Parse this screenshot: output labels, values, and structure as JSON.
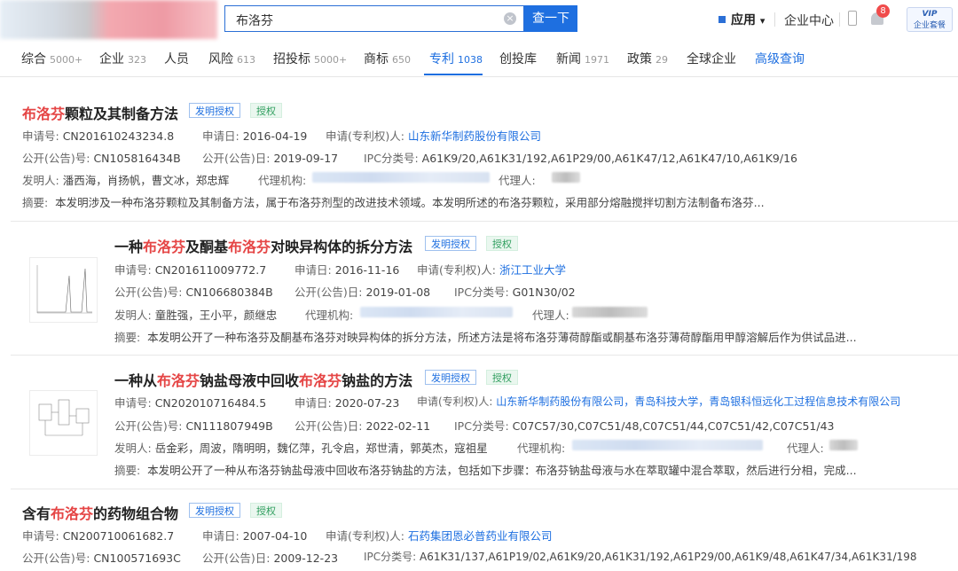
{
  "header": {
    "search": {
      "value": "布洛芬",
      "clear": "×",
      "button": "查一下"
    },
    "apps_label": "应用",
    "apps_caret": "▾",
    "enterprise_center": "企业中心",
    "notification_count": "8",
    "vip": {
      "top": "VIP",
      "bottom": "企业套餐"
    }
  },
  "tabs": [
    {
      "label": "综合",
      "count": "5000+"
    },
    {
      "label": "企业",
      "count": "323"
    },
    {
      "label": "人员",
      "count": ""
    },
    {
      "label": "风险",
      "count": "613"
    },
    {
      "label": "招投标",
      "count": "5000+"
    },
    {
      "label": "商标",
      "count": "650"
    },
    {
      "label": "专利",
      "count": "1038"
    },
    {
      "label": "创投库",
      "count": ""
    },
    {
      "label": "新闻",
      "count": "1971"
    },
    {
      "label": "政策",
      "count": "29"
    },
    {
      "label": "全球企业",
      "count": ""
    },
    {
      "label": "高级查询",
      "count": ""
    }
  ],
  "active_tab": "专利",
  "results": [
    {
      "title_parts": [
        {
          "t": "布洛芬",
          "hl": true
        },
        {
          "t": "颗粒及其制备方法",
          "hl": false
        }
      ],
      "tag_type": "发明授权",
      "tag_status": "授权",
      "app_no_label": "申请号:",
      "app_no": "CN201610243234.8",
      "app_date_label": "申请日:",
      "app_date": "2016-04-19",
      "applicant_label": "申请(专利权)人:",
      "applicant": "山东新华制药股份有限公司",
      "pub_no_label": "公开(公告)号:",
      "pub_no": "CN105816434B",
      "pub_date_label": "公开(公告)日:",
      "pub_date": "2019-09-17",
      "ipc_label": "IPC分类号:",
      "ipc": "A61K9/20,A61K31/192,A61P29/00,A61K47/12,A61K47/10,A61K9/16",
      "inventor_label": "发明人:",
      "inventors": "潘西海，肖扬帆，曹文冰，郑忠辉",
      "agency_label": "代理机构:",
      "agent_label": "代理人:",
      "abstract_label": "摘要:",
      "abstract": "本发明涉及一种布洛芬颗粒及其制备方法，属于布洛芬剂型的改进技术领域。本发明所述的布洛芬颗粒，采用部分熔融搅拌切割方法制备布洛芬..."
    },
    {
      "title_parts": [
        {
          "t": "一种",
          "hl": false
        },
        {
          "t": "布洛芬",
          "hl": true
        },
        {
          "t": "及酮基",
          "hl": false
        },
        {
          "t": "布洛芬",
          "hl": true
        },
        {
          "t": "对映异构体的拆分方法",
          "hl": false
        }
      ],
      "tag_type": "发明授权",
      "tag_status": "授权",
      "app_no_label": "申请号:",
      "app_no": "CN201611009772.7",
      "app_date_label": "申请日:",
      "app_date": "2016-11-16",
      "applicant_label": "申请(专利权)人:",
      "applicant": "浙江工业大学",
      "pub_no_label": "公开(公告)号:",
      "pub_no": "CN106680384B",
      "pub_date_label": "公开(公告)日:",
      "pub_date": "2019-01-08",
      "ipc_label": "IPC分类号:",
      "ipc": "G01N30/02",
      "inventor_label": "发明人:",
      "inventors": "童胜强，王小平，颜继忠",
      "agency_label": "代理机构:",
      "agent_label": "代理人:",
      "abstract_label": "摘要:",
      "abstract": "本发明公开了一种布洛芬及酮基布洛芬对映异构体的拆分方法，所述方法是将布洛芬薄荷醇酯或酮基布洛芬薄荷醇酯用甲醇溶解后作为供试品进..."
    },
    {
      "title_parts": [
        {
          "t": "一种从",
          "hl": false
        },
        {
          "t": "布洛芬",
          "hl": true
        },
        {
          "t": "钠盐母液中回收",
          "hl": false
        },
        {
          "t": "布洛芬",
          "hl": true
        },
        {
          "t": "钠盐的方法",
          "hl": false
        }
      ],
      "tag_type": "发明授权",
      "tag_status": "授权",
      "app_no_label": "申请号:",
      "app_no": "CN202010716484.5",
      "app_date_label": "申请日:",
      "app_date": "2020-07-23",
      "applicant_label": "申请(专利权)人:",
      "applicant": "山东新华制药股份有限公司，青岛科技大学，青岛银科恒远化工过程信息技术有限公司",
      "pub_no_label": "公开(公告)号:",
      "pub_no": "CN111807949B",
      "pub_date_label": "公开(公告)日:",
      "pub_date": "2022-02-11",
      "ipc_label": "IPC分类号:",
      "ipc": "C07C57/30,C07C51/48,C07C51/44,C07C51/42,C07C51/43",
      "inventor_label": "发明人:",
      "inventors": "岳金彩，周波，隋明明，魏亿萍，孔令启，郑世清，郭英杰，寇祖星",
      "agency_label": "代理机构:",
      "agent_label": "代理人:",
      "abstract_label": "摘要:",
      "abstract": "本发明公开了一种从布洛芬钠盐母液中回收布洛芬钠盐的方法，包括如下步骤：布洛芬钠盐母液与水在萃取罐中混合萃取，然后进行分相，完成..."
    },
    {
      "title_parts": [
        {
          "t": "含有",
          "hl": false
        },
        {
          "t": "布洛芬",
          "hl": true
        },
        {
          "t": "的药物组合物",
          "hl": false
        }
      ],
      "tag_type": "发明授权",
      "tag_status": "授权",
      "app_no_label": "申请号:",
      "app_no": "CN200710061682.7",
      "app_date_label": "申请日:",
      "app_date": "2007-04-10",
      "applicant_label": "申请(专利权)人:",
      "applicant": "石药集团恩必普药业有限公司",
      "pub_no_label": "公开(公告)号:",
      "pub_no": "CN100571693C",
      "pub_date_label": "公开(公告)日:",
      "pub_date": "2009-12-23",
      "ipc_label": "IPC分类号:",
      "ipc": "A61K31/137,A61P19/02,A61K9/20,A61K31/192,A61P29/00,A61K9/48,A61K47/34,A61K31/198"
    }
  ]
}
